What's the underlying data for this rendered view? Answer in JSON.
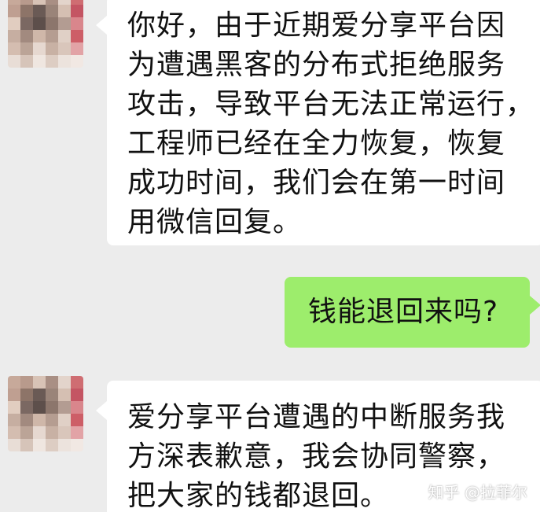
{
  "messages": [
    {
      "side": "left",
      "lines": [
        "你好，由于近期爱分享平台因",
        "为遭遇黑客的分布式拒绝服务",
        "攻击，导致平台无法正常运行，",
        "工程师已经在全力恢复，恢复",
        "成功时间，我们会在第一时间",
        "用微信回复。"
      ]
    },
    {
      "side": "right",
      "text": "钱能退回来吗?"
    },
    {
      "side": "left",
      "lines": [
        "爱分享平台遭遇的中断服务我",
        "方深表歉意，我会协同警察，",
        "把大家的钱都退回。"
      ]
    }
  ],
  "watermark": "知乎 @拉菲尔",
  "colors": {
    "background": "#ececec",
    "incoming_bubble": "#ffffff",
    "outgoing_bubble": "#9ded6c"
  },
  "avatar_palette": [
    "#c7a99a",
    "#b89a8c",
    "#d8c3b6",
    "#a98f84",
    "#e3d4cb",
    "#cf6d72",
    "#bf9f91",
    "#8d7468",
    "#6a5a55",
    "#9a8479",
    "#d5bfb2",
    "#c45563",
    "#e1cdc0",
    "#7b6862",
    "#5d4f4b",
    "#8c766c",
    "#b39c92",
    "#d9868c",
    "#c6aea1",
    "#a28a7f",
    "#cfb7a9",
    "#b59d91",
    "#e0d0c6",
    "#cd5e67",
    "#d4bdb0",
    "#bba497",
    "#e6d8d0",
    "#c8b1a4",
    "#d9c6bb",
    "#e2a3a6",
    "#e8ddd6",
    "#d6c4b9",
    "#efe6e0",
    "#ddcdc3",
    "#ece3dd",
    "#f1e8e3"
  ]
}
